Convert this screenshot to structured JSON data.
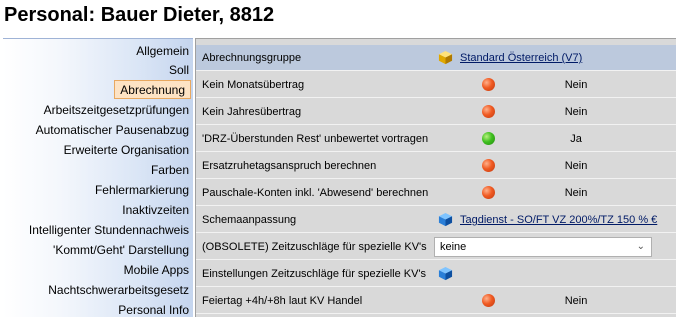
{
  "title": "Personal: Bauer Dieter, 8812",
  "sidebar": {
    "items": [
      {
        "label": "Allgemein"
      },
      {
        "label": "Soll"
      },
      {
        "label": "Abrechnung"
      },
      {
        "label": "Arbeitszeitgesetzprüfungen"
      },
      {
        "label": "Automatischer Pausenabzug"
      },
      {
        "label": "Erweiterte Organisation"
      },
      {
        "label": "Farben"
      },
      {
        "label": "Fehlermarkierung"
      },
      {
        "label": "Inaktivzeiten"
      },
      {
        "label": "Intelligenter Stundennachweis"
      },
      {
        "label": "'Kommt/Geht' Darstellung"
      },
      {
        "label": "Mobile Apps"
      },
      {
        "label": "Nachtschwerarbeitsgesetz"
      },
      {
        "label": "Personal Info"
      }
    ],
    "active_index": 2
  },
  "rows": [
    {
      "label": "Abrechnungsgruppe",
      "link": "Standard Österreich (V7)",
      "icon": "gold-cube-icon"
    },
    {
      "label": "Kein Monatsübertrag",
      "status": "red",
      "value": "Nein"
    },
    {
      "label": "Kein Jahresübertrag",
      "status": "red",
      "value": "Nein"
    },
    {
      "label": "'DRZ-Überstunden Rest' unbewertet vortragen",
      "status": "green",
      "value": "Ja"
    },
    {
      "label": "Ersatzruhetagsanspruch berechnen",
      "status": "red",
      "value": "Nein"
    },
    {
      "label": "Pauschale-Konten inkl. 'Abwesend' berechnen",
      "status": "red",
      "value": "Nein"
    },
    {
      "label": "Schemaanpassung",
      "link": "Tagdienst - SO/FT VZ 200%/TZ 150 % €",
      "icon": "blue-cube-icon"
    },
    {
      "label": "(OBSOLETE) Zeitzuschläge für spezielle KV's",
      "select_value": "keine"
    },
    {
      "label": "Einstellungen Zeitzuschläge für spezielle KV's",
      "icon": "blue-cube-icon"
    },
    {
      "label": "Feiertag +4h/+8h laut KV Handel",
      "status": "red",
      "value": "Nein"
    }
  ],
  "colors": {
    "header_row": "#bcc9dd",
    "row_bg": "#d9d9d9",
    "active_nav_bg": "#fde3c4",
    "status_red": "#f05a22",
    "status_green": "#3fbf1f"
  }
}
